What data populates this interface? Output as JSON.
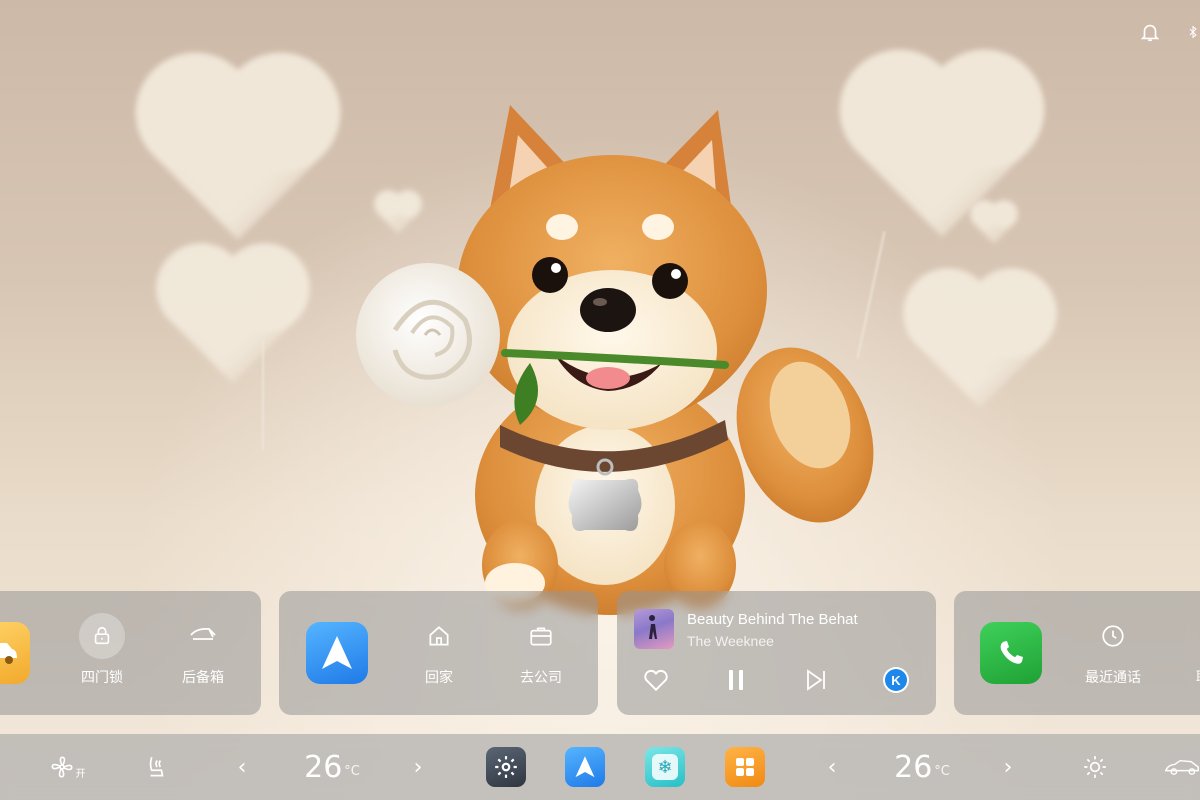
{
  "vehicle_card": {
    "lock_label": "四门锁",
    "trunk_label": "后备箱"
  },
  "nav_card": {
    "home_label": "回家",
    "work_label": "去公司"
  },
  "music_card": {
    "title": "Beauty Behind The Behat",
    "artist": "The Weeknee",
    "liked": false,
    "playing": true
  },
  "phone_card": {
    "recent_calls_label": "最近通话",
    "contacts_label_partial": "联"
  },
  "dock": {
    "fan_label": "开",
    "left_temp": "26",
    "right_temp": "26",
    "temp_unit": "°C"
  },
  "colors": {
    "nav_blue": "#2f8ff5",
    "phone_green": "#27b33f",
    "climate_teal": "#3fd0d6",
    "apps_orange": "#f39a1e",
    "vehicle_yellow": "#f3b63b"
  },
  "icons": {
    "status": [
      "bell-icon",
      "bluetooth-icon"
    ],
    "dock": [
      "fan-icon",
      "seat-icon",
      "chevron-left-icon",
      "chevron-right-icon",
      "settings-icon",
      "navigation-icon",
      "climate-icon",
      "apps-grid-icon",
      "brightness-icon",
      "car-icon"
    ]
  }
}
